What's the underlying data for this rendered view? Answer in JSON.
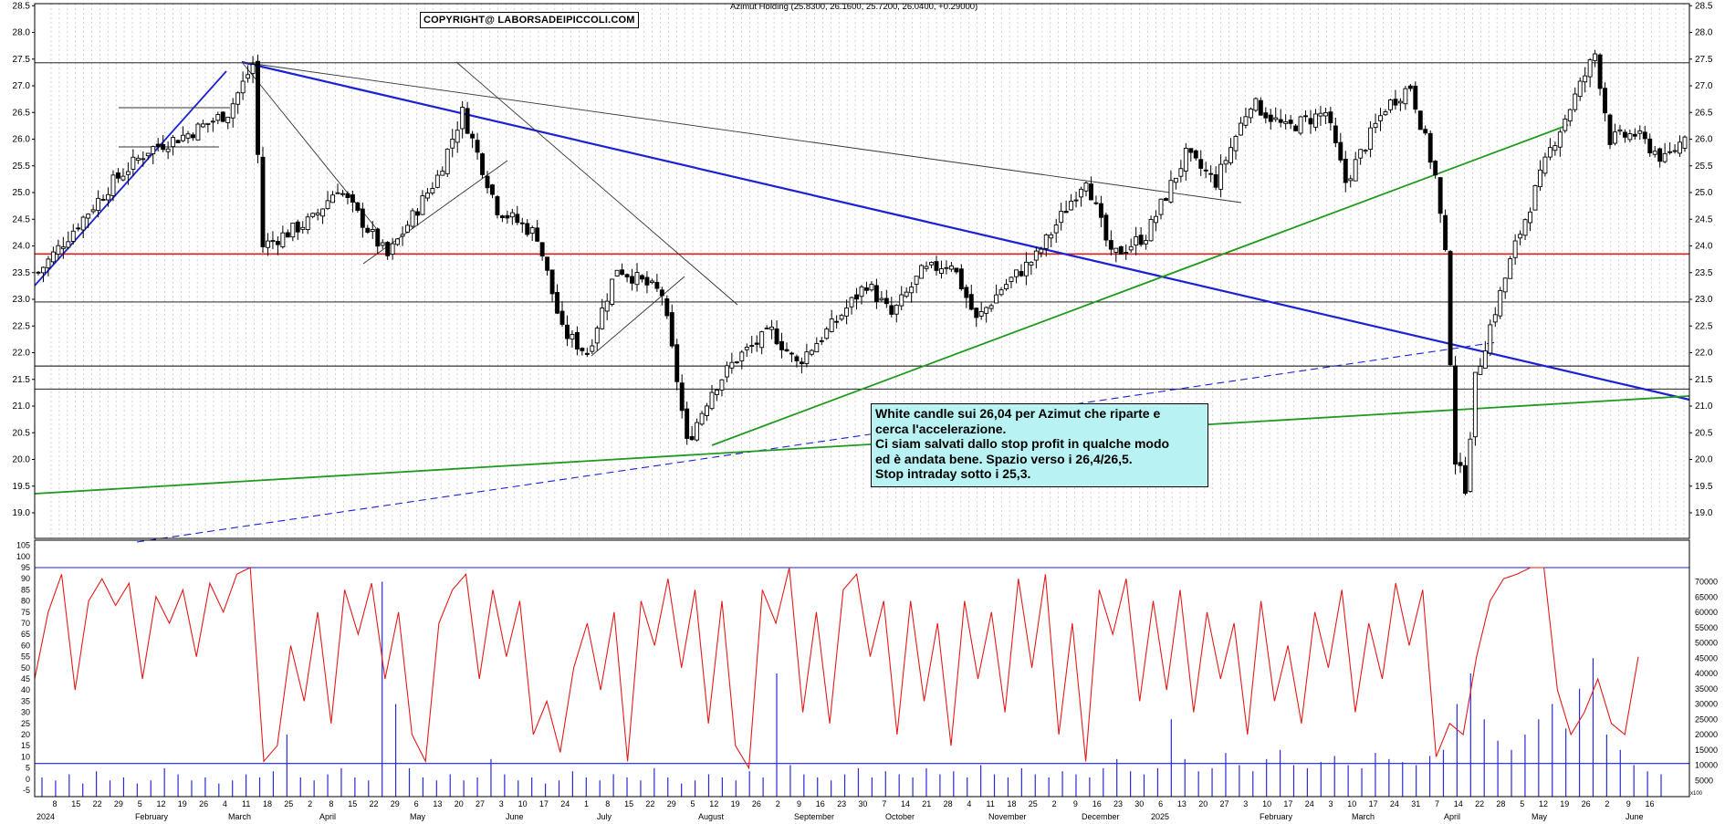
{
  "copyright": "COPYRIGHT@ LABORSADEIPICCOLI.COM",
  "quote": "Azimut Holding (25.8300, 26.1600, 25.7200, 26.0400, +0.29000)",
  "annotation": [
    "White candle sui 26,04 per Azimut che riparte e",
    "cerca l'accelerazione.",
    "Ci siam salvati dallo stop profit in qualche modo",
    "ed è andata bene. Spazio verso i 26,4/26,5.",
    "Stop intraday sotto i 25,3."
  ],
  "colors": {
    "trend_blue": "#1b22d6",
    "support_red": "#e21b1b",
    "trend_green": "#1f9a1f",
    "oscillator": "#e21b1b",
    "volume": "#2a2ad8",
    "note_bg": "#b8f2f2"
  },
  "chart_data": [
    {
      "type": "candlestick",
      "title": "Azimut Holding",
      "ylim": [
        18.5,
        28.5
      ],
      "yticks": [
        19.0,
        19.5,
        20.0,
        20.5,
        21.0,
        21.5,
        22.0,
        22.5,
        23.0,
        23.5,
        24.0,
        24.5,
        25.0,
        25.5,
        26.0,
        26.5,
        27.0,
        27.5,
        28.0,
        28.5
      ],
      "grid": "vertical dotted",
      "horizontal_levels": [
        27.43,
        23.85,
        22.95,
        21.75,
        21.32
      ],
      "support_red": 23.85,
      "ohlc_trend": [
        [
          0,
          23.5
        ],
        [
          7,
          24.3
        ],
        [
          15,
          25.2
        ],
        [
          22,
          25.8
        ],
        [
          30,
          26.1
        ],
        [
          38,
          26.5
        ],
        [
          43,
          27.4
        ],
        [
          45,
          24.0
        ],
        [
          55,
          24.5
        ],
        [
          60,
          25.1
        ],
        [
          70,
          23.8
        ],
        [
          80,
          25.3
        ],
        [
          85,
          26.5
        ],
        [
          92,
          24.7
        ],
        [
          100,
          24.2
        ],
        [
          105,
          22.4
        ],
        [
          110,
          22.0
        ],
        [
          116,
          23.6
        ],
        [
          125,
          23.1
        ],
        [
          128,
          21.5
        ],
        [
          130,
          20.3
        ],
        [
          135,
          21.3
        ],
        [
          140,
          21.9
        ],
        [
          147,
          22.4
        ],
        [
          152,
          21.8
        ],
        [
          160,
          22.6
        ],
        [
          166,
          23.3
        ],
        [
          171,
          22.7
        ],
        [
          177,
          23.5
        ],
        [
          183,
          23.7
        ],
        [
          188,
          22.6
        ],
        [
          193,
          23.2
        ],
        [
          200,
          23.8
        ],
        [
          210,
          25.3
        ],
        [
          215,
          23.8
        ],
        [
          222,
          24.2
        ],
        [
          230,
          25.7
        ],
        [
          236,
          25.2
        ],
        [
          243,
          26.7
        ],
        [
          250,
          26.2
        ],
        [
          258,
          26.5
        ],
        [
          262,
          25.2
        ],
        [
          270,
          26.6
        ],
        [
          275,
          27.0
        ],
        [
          280,
          25.3
        ],
        [
          282,
          23.8
        ],
        [
          284,
          20.0
        ],
        [
          286,
          19.5
        ],
        [
          288,
          21.5
        ],
        [
          291,
          22.5
        ],
        [
          296,
          24.0
        ],
        [
          303,
          25.8
        ],
        [
          308,
          26.8
        ],
        [
          312,
          27.6
        ],
        [
          315,
          26.0
        ],
        [
          320,
          26.1
        ],
        [
          326,
          25.6
        ],
        [
          330,
          26.04
        ]
      ],
      "last": {
        "open": 25.83,
        "high": 26.16,
        "low": 25.72,
        "close": 26.04,
        "change": 0.29
      }
    },
    {
      "type": "line",
      "name": "oscillator",
      "ylim": [
        -5,
        105
      ],
      "yticks": [
        -5,
        0,
        5,
        10,
        15,
        20,
        25,
        30,
        35,
        40,
        45,
        50,
        55,
        60,
        65,
        70,
        75,
        80,
        85,
        90,
        95,
        100,
        105
      ],
      "levels": [
        95,
        7
      ],
      "values": [
        45,
        75,
        92,
        40,
        80,
        90,
        78,
        88,
        45,
        82,
        70,
        85,
        55,
        88,
        75,
        92,
        95,
        8,
        15,
        60,
        35,
        75,
        25,
        85,
        65,
        88,
        45,
        75,
        20,
        8,
        70,
        85,
        92,
        45,
        85,
        55,
        80,
        20,
        35,
        12,
        50,
        70,
        40,
        75,
        8,
        80,
        60,
        90,
        50,
        85,
        25,
        80,
        15,
        5,
        85,
        70,
        95,
        30,
        75,
        25,
        85,
        92,
        55,
        80,
        20,
        80,
        35,
        70,
        15,
        80,
        45,
        75,
        30,
        90,
        50,
        92,
        20,
        70,
        8,
        85,
        65,
        90,
        35,
        80,
        40,
        85,
        30,
        75,
        45,
        70,
        20,
        80,
        35,
        60,
        25,
        75,
        50,
        85,
        30,
        70,
        45,
        88,
        60,
        85,
        10,
        25,
        20,
        55,
        80,
        90,
        92,
        95,
        95,
        40,
        20,
        30,
        45,
        25,
        20,
        55
      ]
    },
    {
      "type": "bar",
      "name": "volume",
      "ylim": [
        0,
        75000
      ],
      "yticks": [
        5000,
        10000,
        15000,
        20000,
        25000,
        30000,
        35000,
        40000,
        45000,
        50000,
        55000,
        60000,
        65000,
        70000
      ],
      "values": [
        6000,
        5000,
        7000,
        4000,
        8000,
        5000,
        6000,
        4000,
        5000,
        9000,
        7000,
        5000,
        6000,
        4000,
        5000,
        7000,
        6000,
        8000,
        20000,
        6000,
        5000,
        7000,
        9000,
        6000,
        5000,
        70000,
        30000,
        9000,
        6000,
        5000,
        7000,
        5000,
        6000,
        12000,
        7000,
        5000,
        6000,
        4000,
        5000,
        8000,
        6000,
        5000,
        7000,
        6000,
        5000,
        9000,
        6000,
        4000,
        5000,
        7000,
        6000,
        5000,
        8000,
        6000,
        40000,
        10000,
        7000,
        6000,
        5000,
        7000,
        9000,
        6000,
        8000,
        7000,
        6000,
        9000,
        7000,
        8000,
        6000,
        10000,
        7000,
        6000,
        9000,
        7000,
        6000,
        8000,
        7000,
        6000,
        9000,
        12000,
        8000,
        7000,
        9000,
        25000,
        12000,
        8000,
        9000,
        14000,
        10000,
        8000,
        12000,
        15000,
        10000,
        9000,
        11000,
        13000,
        10000,
        9000,
        14000,
        12000,
        11000,
        10000,
        13000,
        15000,
        30000,
        40000,
        25000,
        18000,
        15000,
        20000,
        25000,
        30000,
        22000,
        35000,
        45000,
        20000,
        15000,
        10000,
        8000,
        7000
      ]
    }
  ],
  "axis": {
    "price_ticks": [
      "19.0",
      "19.5",
      "20.0",
      "20.5",
      "21.0",
      "21.5",
      "22.0",
      "22.5",
      "23.0",
      "23.5",
      "24.0",
      "24.5",
      "25.0",
      "25.5",
      "26.0",
      "26.5",
      "27.0",
      "27.5",
      "28.0",
      "28.5"
    ],
    "osc_ticks": [
      "-5",
      "0",
      "5",
      "10",
      "15",
      "20",
      "25",
      "30",
      "35",
      "40",
      "45",
      "50",
      "55",
      "60",
      "65",
      "70",
      "75",
      "80",
      "85",
      "90",
      "95",
      "100",
      "105"
    ],
    "vol_ticks": [
      "5000",
      "10000",
      "15000",
      "20000",
      "25000",
      "30000",
      "35000",
      "40000",
      "45000",
      "50000",
      "55000",
      "60000",
      "65000",
      "70000"
    ],
    "vol_unit": "x100",
    "day_ticks": [
      "8",
      "15",
      "22",
      "29",
      "5",
      "12",
      "19",
      "26",
      "4",
      "11",
      "18",
      "25",
      "2",
      "8",
      "15",
      "22",
      "29",
      "6",
      "13",
      "20",
      "27",
      "3",
      "10",
      "17",
      "24",
      "1",
      "8",
      "15",
      "22",
      "29",
      "5",
      "12",
      "19",
      "26",
      "2",
      "9",
      "16",
      "23",
      "30",
      "7",
      "14",
      "21",
      "28",
      "4",
      "11",
      "18",
      "25",
      "2",
      "9",
      "16",
      "23",
      "30",
      "6",
      "13",
      "20",
      "27",
      "3",
      "10",
      "17",
      "24",
      "3",
      "10",
      "17",
      "24",
      "31",
      "7",
      "14",
      "22",
      "28",
      "5",
      "12",
      "19",
      "26",
      "2",
      "9",
      "16"
    ],
    "month_labels": [
      "2024",
      "February",
      "March",
      "April",
      "May",
      "June",
      "July",
      "August",
      "September",
      "October",
      "November",
      "December",
      "2025",
      "February",
      "March",
      "April",
      "May",
      "June"
    ]
  }
}
